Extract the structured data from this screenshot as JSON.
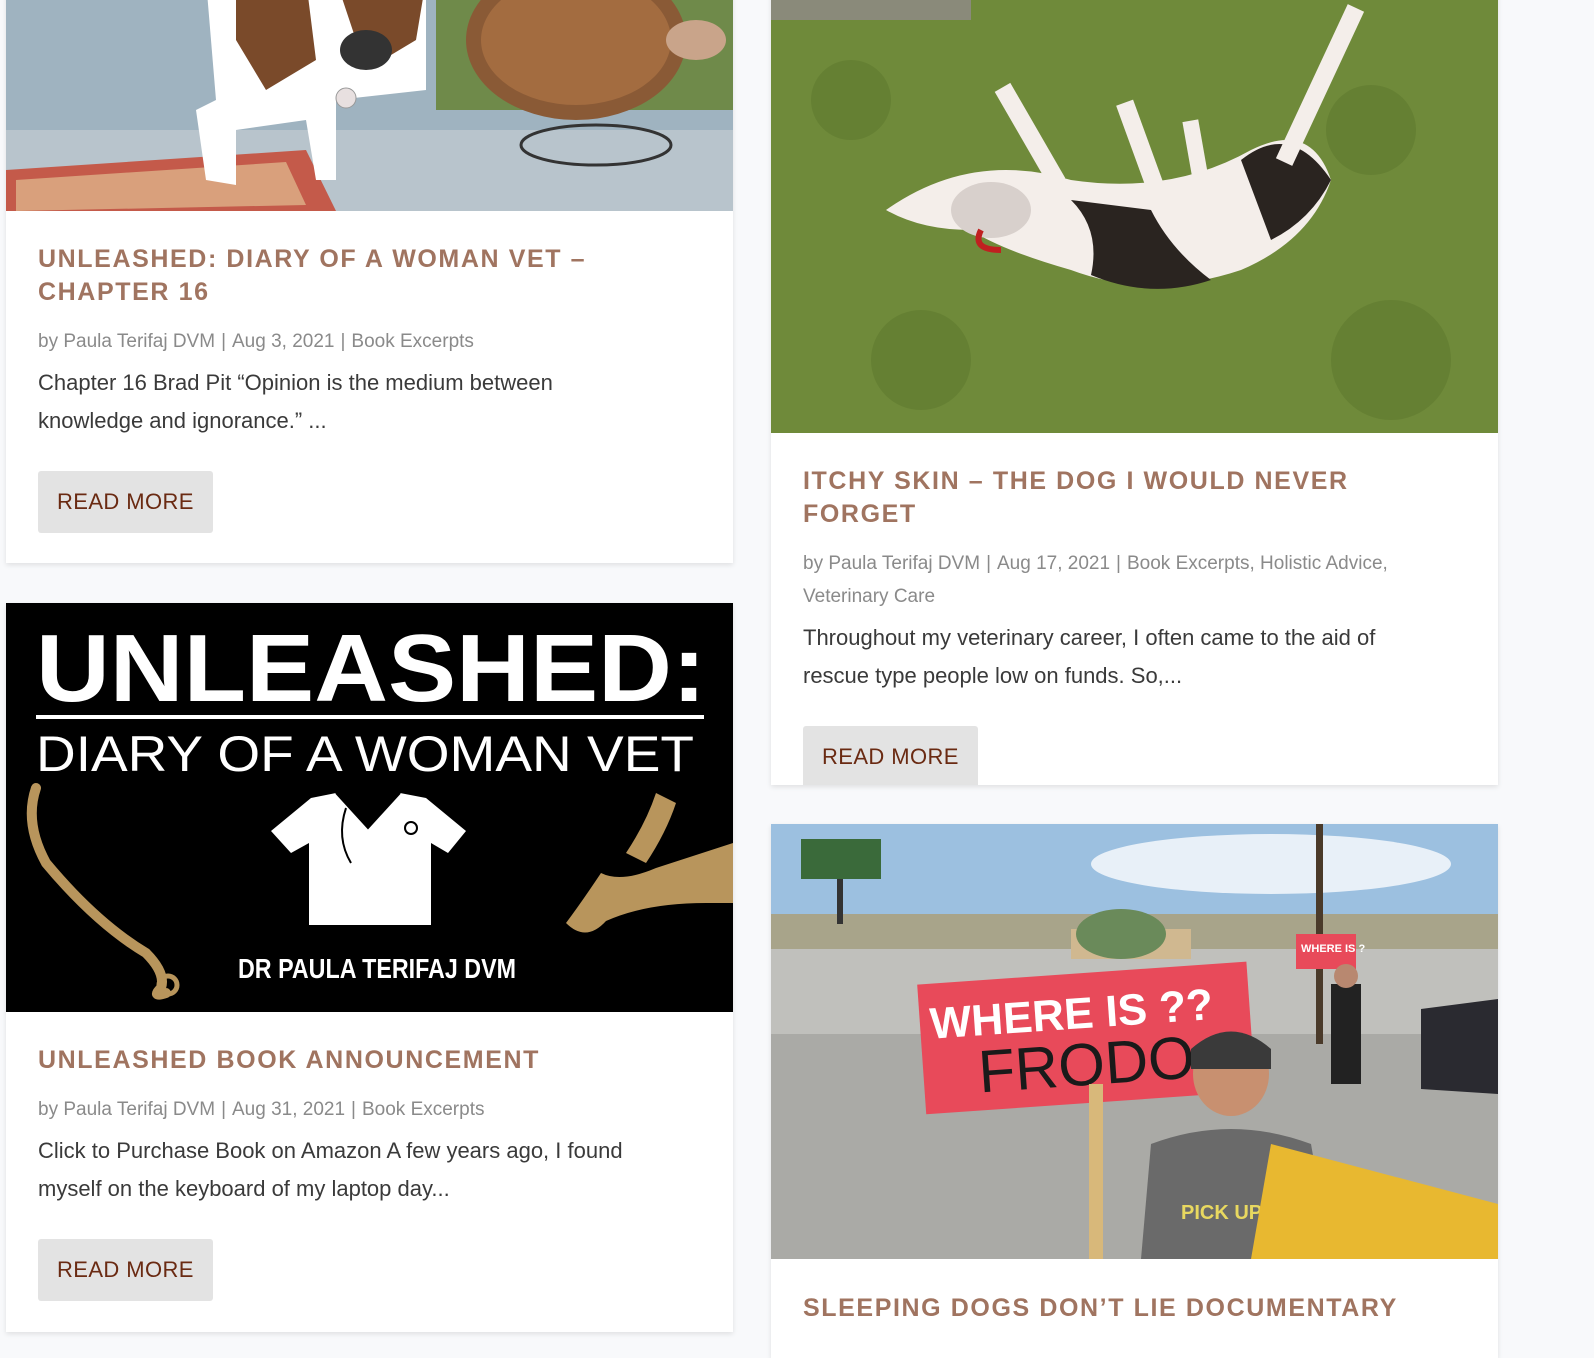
{
  "posts": [
    {
      "title": "UNLEASHED: DIARY OF A WOMAN VET – CHAPTER 16",
      "author": "by Paula Terifaj DVM",
      "date": "Aug 3, 2021",
      "categories": "Book Excerpts",
      "excerpt": "Chapter 16  Brad Pit  “Opinion is the medium between knowledge and ignorance.” ...",
      "read_more": "READ MORE"
    },
    {
      "title": "ITCHY SKIN – THE DOG I WOULD NEVER FORGET",
      "author": "by Paula Terifaj DVM",
      "date": "Aug 17, 2021",
      "categories": "Book Excerpts, Holistic Advice, Veterinary Care",
      "excerpt": "Throughout my veterinary career, I often came to the aid of rescue type people low on funds. So,...",
      "read_more": "READ MORE"
    },
    {
      "title": "UNLEASHED BOOK ANNOUNCEMENT",
      "author": "by Paula Terifaj DVM",
      "date": "Aug 31, 2021",
      "categories": "Book Excerpts",
      "excerpt": "Click to Purchase Book on Amazon A few years ago, I found myself on the keyboard of my laptop day...",
      "read_more": "READ MORE",
      "banner": {
        "headline": "UNLEASHED:",
        "subtitle": "DIARY OF A WOMAN VET",
        "author": "DR PAULA TERIFAJ DVM"
      }
    },
    {
      "title": "SLEEPING DOGS DON’T LIE DOCUMENTARY",
      "sign_where": "WHERE IS ??",
      "sign_frodo": "FRODO",
      "sign_small": "WHERE IS ?",
      "shirt_text": "PICK UP CREW"
    }
  ],
  "separator": "|",
  "colors": {
    "title": "#a07460",
    "button_text": "#6a2a12",
    "button_bg": "#e3e3e3",
    "page_bg": "#f8f9fb"
  }
}
